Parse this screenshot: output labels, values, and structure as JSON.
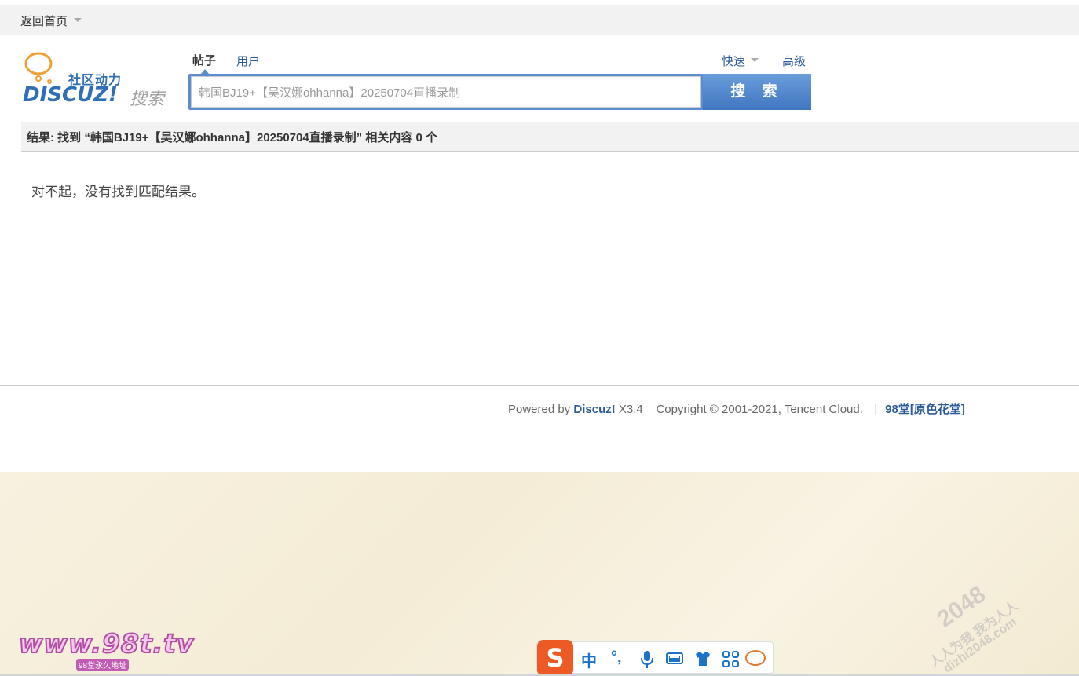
{
  "topbar": {
    "home_label": "返回首页"
  },
  "logo": {
    "cn": "社区动力",
    "brand": "DISCUZ!",
    "suffix": "搜索"
  },
  "tabs": {
    "posts": "帖子",
    "users": "用户"
  },
  "links": {
    "quick": "快速",
    "advanced": "高级"
  },
  "search": {
    "value": "韩国BJ19+【吴汉娜ohhanna】20250704直播录制",
    "button": "搜 索"
  },
  "result": {
    "summary": "结果: 找到 “韩国BJ19+【吴汉娜ohhanna】20250704直播录制” 相关内容 0 个",
    "empty": "对不起，没有找到匹配结果。"
  },
  "footer": {
    "powered": "Powered by ",
    "brand": "Discuz!",
    "version": " X3.4",
    "copyright": "Copyright © 2001-2021, Tencent Cloud.",
    "sep": "|",
    "site": "98堂[原色花堂]"
  },
  "watermarks": {
    "site98": "www.98t.tv",
    "site98_sub": "98堂永久地址",
    "w2048_big": "2048",
    "w2048_line2": "人人为我 我为人人",
    "w2048_line3": "dizhi2048.com"
  },
  "ime": {
    "logo": "S",
    "lang": "中",
    "punct": "°,",
    "icons": [
      "microphone-icon",
      "keyboard-icon",
      "skin-icon",
      "toolbox-icon",
      "mascot-icon"
    ]
  }
}
